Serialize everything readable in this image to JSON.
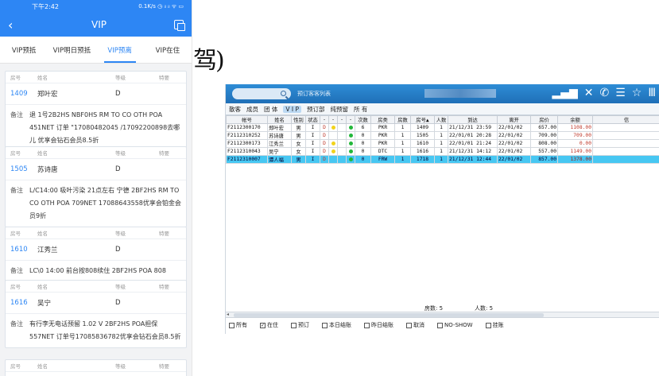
{
  "phone": {
    "status": {
      "time": "下午2:42",
      "network": "0.1K/s ◷ ᵢₗ ᵢₗ ᯤ ▭"
    },
    "titlebar": {
      "back": "‹",
      "title": "VIP"
    },
    "tabs": [
      {
        "label": "VIP预抵",
        "active": false
      },
      {
        "label": "VIP明日预抵",
        "active": false
      },
      {
        "label": "VIP预离",
        "active": true
      },
      {
        "label": "VIP在住",
        "active": false
      }
    ],
    "card_header": {
      "room": "房号",
      "name": "姓名",
      "grade": "等级",
      "special": "特要"
    },
    "note_label": "备注",
    "cards": [
      {
        "room": "1409",
        "name": "郑叶宏",
        "grade": "D",
        "note": "退 1号2B2HS NBF0HS RM TO CO OTH POA 451NET 订单 \"17080482045 /17092200898去哪儿 优享会钻石会员8.5折"
      },
      {
        "room": "1505",
        "name": "苏诗唐",
        "grade": "D",
        "note": "L/C14:00 吸叶污染 21点左右 宁德 2BF2HS RM TO CO OTH POA 709NET 17088643558优享会铂金会员9折"
      },
      {
        "room": "1610",
        "name": "江秀兰",
        "grade": "D",
        "note": "LC\\0 14:00 前台按808续住 2BF2HS POA 808"
      },
      {
        "room": "1616",
        "name": "吴宁",
        "grade": "D",
        "note": "有行李无电话预留 1.02 V 2BF2HS POA担保 557NET 订单号17085836782优享会钻石会员8.5折"
      },
      {
        "room": "",
        "name": "",
        "grade": "",
        "note": ""
      }
    ]
  },
  "fragment": "驾)",
  "pms": {
    "search_caption": "预订客客列表",
    "menu": [
      "散客",
      "成员",
      "团 体",
      "V I P",
      "预订部",
      "纯预留",
      "所 有"
    ],
    "menu_selected": 3,
    "columns": [
      "帐号",
      "姓名",
      "性别",
      "状态",
      "-",
      "-",
      "-",
      "-",
      "次数",
      "房类",
      "房数",
      "房号▲",
      "人数",
      "到达",
      "离开",
      "房价",
      "余额",
      "信"
    ],
    "rows": [
      [
        "F2112300170",
        "郑叶宏",
        "男",
        "I",
        "D",
        "y",
        "",
        "",
        "g",
        "6",
        "PKR",
        "1",
        "1409",
        "1",
        "21/12/31 23:59",
        "22/01/02",
        "657.00",
        "1108.00",
        ""
      ],
      [
        "F2112310252",
        "苏诗唐",
        "男",
        "I",
        "D",
        "",
        "",
        "",
        "g",
        "0",
        "PKR",
        "1",
        "1505",
        "1",
        "22/01/01 20:28",
        "22/01/02",
        "709.00",
        "709.00",
        ""
      ],
      [
        "F2112300173",
        "江秀兰",
        "女",
        "I",
        "D",
        "y",
        "",
        "",
        "g",
        "0",
        "PKR",
        "1",
        "1610",
        "1",
        "22/01/01 21:24",
        "22/01/02",
        "808.00",
        "0.00",
        ""
      ],
      [
        "F2112310043",
        "吴宁",
        "女",
        "I",
        "D",
        "y",
        "",
        "",
        "g",
        "0",
        "DTC",
        "1",
        "1616",
        "1",
        "21/12/31 14:12",
        "22/01/02",
        "557.00",
        "1149.00",
        ""
      ],
      [
        "F2112310007",
        "谭人福",
        "男",
        "I",
        "D",
        "",
        "",
        "",
        "g",
        "0",
        "FRW",
        "1",
        "1718",
        "1",
        "21/12/31 12:44",
        "22/01/02",
        "857.00",
        "1378.00",
        ""
      ]
    ],
    "selected_row": 4,
    "summary": {
      "rooms": "房数: 5",
      "people": "人数: 5"
    },
    "filters": [
      {
        "label": "所有",
        "checked": false
      },
      {
        "label": "在住",
        "checked": true
      },
      {
        "label": "预订",
        "checked": false
      },
      {
        "label": "本日结账",
        "checked": false
      },
      {
        "label": "昨日结账",
        "checked": false
      },
      {
        "label": "取消",
        "checked": false
      },
      {
        "label": "NO-SHOW",
        "checked": false
      },
      {
        "label": "挂账",
        "checked": false
      }
    ],
    "colors": {
      "header": "#1f6fb7",
      "selected_row": "#47c7f2",
      "balance": "#c0392b"
    }
  }
}
